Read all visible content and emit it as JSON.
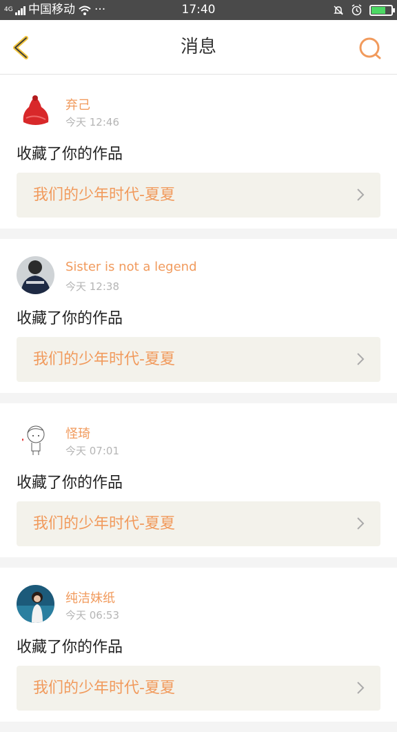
{
  "status_bar": {
    "network": "4G",
    "carrier": "中国移动",
    "dots": "···",
    "time": "17:40"
  },
  "header": {
    "title": "消息",
    "back_icon": "back-chevron-icon",
    "search_icon": "search-icon",
    "accent_color": "#f19a5c"
  },
  "messages": [
    {
      "username": "弃己",
      "timestamp": "今天 12:46",
      "action": "收藏了你的作品",
      "work_title": "我们的少年时代-夏夏"
    },
    {
      "username": "Sister is not a legend",
      "timestamp": "今天 12:38",
      "action": "收藏了你的作品",
      "work_title": "我们的少年时代-夏夏"
    },
    {
      "username": "怪琦",
      "timestamp": "今天 07:01",
      "action": "收藏了你的作品",
      "work_title": "我们的少年时代-夏夏"
    },
    {
      "username": "纯洁妹纸",
      "timestamp": "今天 06:53",
      "action": "收藏了你的作品",
      "work_title": "我们的少年时代-夏夏"
    }
  ]
}
